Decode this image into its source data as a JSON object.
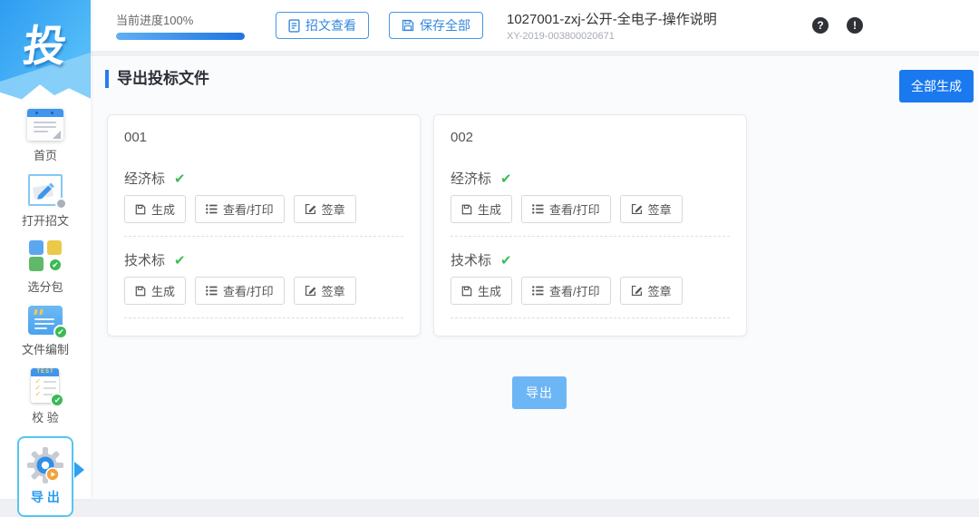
{
  "app": {
    "logo": "投"
  },
  "icons": {
    "check": "✔",
    "help": "?",
    "alert": "!",
    "tick": "✓"
  },
  "colors": {
    "accent_blue": "#1a79ef",
    "light_blue": "#6db6f5",
    "success_green": "#3cba54",
    "active_item_border": "#55c5f2"
  },
  "sidebar": {
    "items": [
      {
        "label": "首页"
      },
      {
        "label": "打开招文"
      },
      {
        "label": "选分包"
      },
      {
        "label": "文件编制"
      },
      {
        "label": "校 验"
      },
      {
        "label": "导 出",
        "active": true
      }
    ],
    "verify_icon_text": "TEST"
  },
  "header": {
    "progress_label": "当前进度100%",
    "progress_percent": 100,
    "view_tender_label": "招文查看",
    "save_all_label": "保存全部",
    "project_title": "1027001-zxj-公开-全电子-操作说明",
    "project_code": "XY-2019-003800020671"
  },
  "main": {
    "section_title": "导出投标文件",
    "generate_all_label": "全部生成",
    "export_label": "导出",
    "button_labels": {
      "generate": "生成",
      "view_print": "查看/打印",
      "sign": "签章"
    },
    "cards": [
      {
        "id": "001",
        "sections": [
          {
            "label": "经济标",
            "checked": true
          },
          {
            "label": "技术标",
            "checked": true
          }
        ]
      },
      {
        "id": "002",
        "sections": [
          {
            "label": "经济标",
            "checked": true
          },
          {
            "label": "技术标",
            "checked": true
          }
        ]
      }
    ]
  }
}
